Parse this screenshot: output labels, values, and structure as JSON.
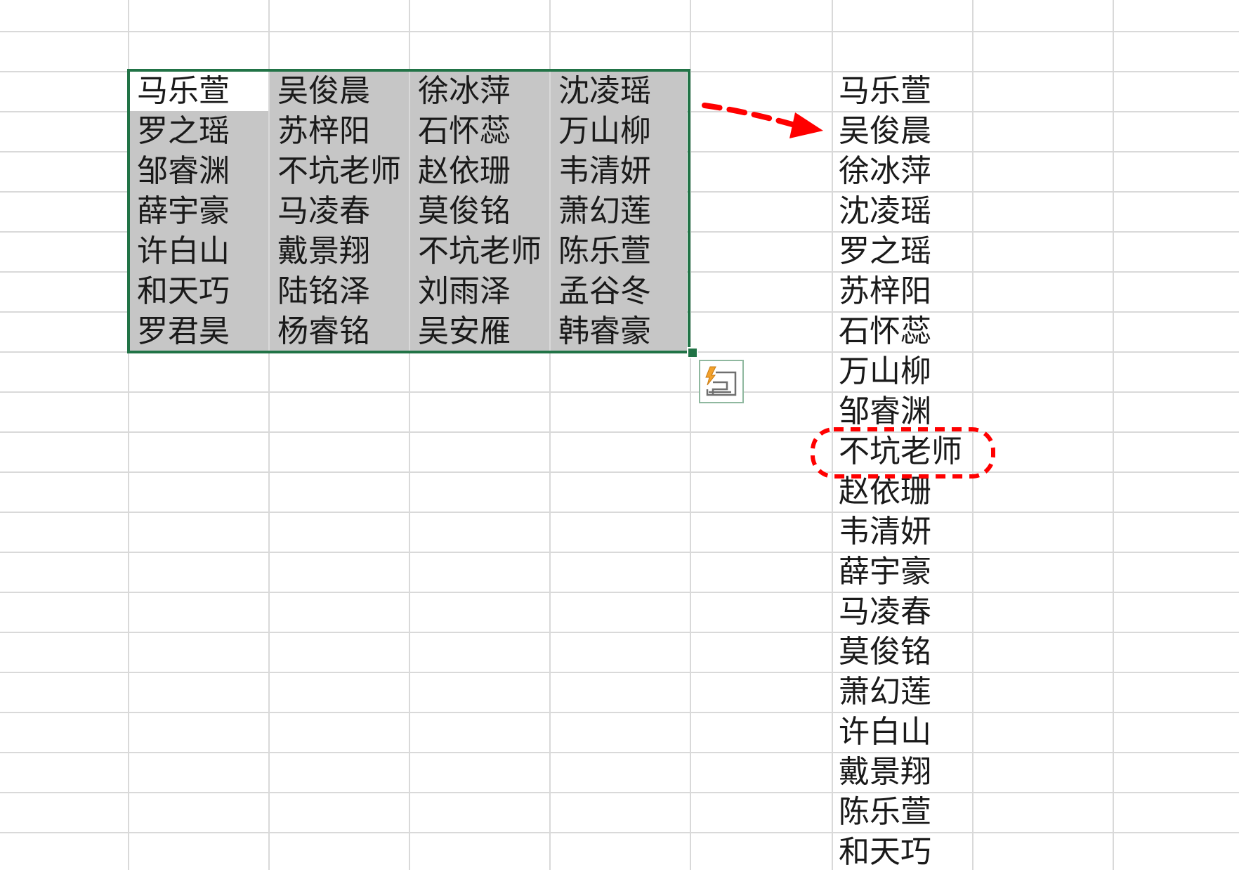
{
  "colors": {
    "selection_border": "#217346",
    "selection_fill": "#c6c6c6",
    "gridline": "#d9d9d9",
    "annotation_red": "#ff0000"
  },
  "quick_analysis_icon": "quick-analysis-icon",
  "source_table": [
    [
      "马乐萱",
      "吴俊晨",
      "徐冰萍",
      "沈凌瑶"
    ],
    [
      "罗之瑶",
      "苏梓阳",
      "石怀蕊",
      "万山柳"
    ],
    [
      "邹睿渊",
      "不坑老师",
      "赵依珊",
      "韦清妍"
    ],
    [
      "薛宇豪",
      "马凌春",
      "莫俊铭",
      "萧幻莲"
    ],
    [
      "许白山",
      "戴景翔",
      "不坑老师",
      "陈乐萱"
    ],
    [
      "和天巧",
      "陆铭泽",
      "刘雨泽",
      "孟谷冬"
    ],
    [
      "罗君昊",
      "杨睿铭",
      "吴安雁",
      "韩睿豪"
    ]
  ],
  "result_column": [
    "马乐萱",
    "吴俊晨",
    "徐冰萍",
    "沈凌瑶",
    "罗之瑶",
    "苏梓阳",
    "石怀蕊",
    "万山柳",
    "邹睿渊",
    "不坑老师",
    "赵依珊",
    "韦清妍",
    "薛宇豪",
    "马凌春",
    "莫俊铭",
    "萧幻莲",
    "许白山",
    "戴景翔",
    "陈乐萱",
    "和天巧"
  ]
}
